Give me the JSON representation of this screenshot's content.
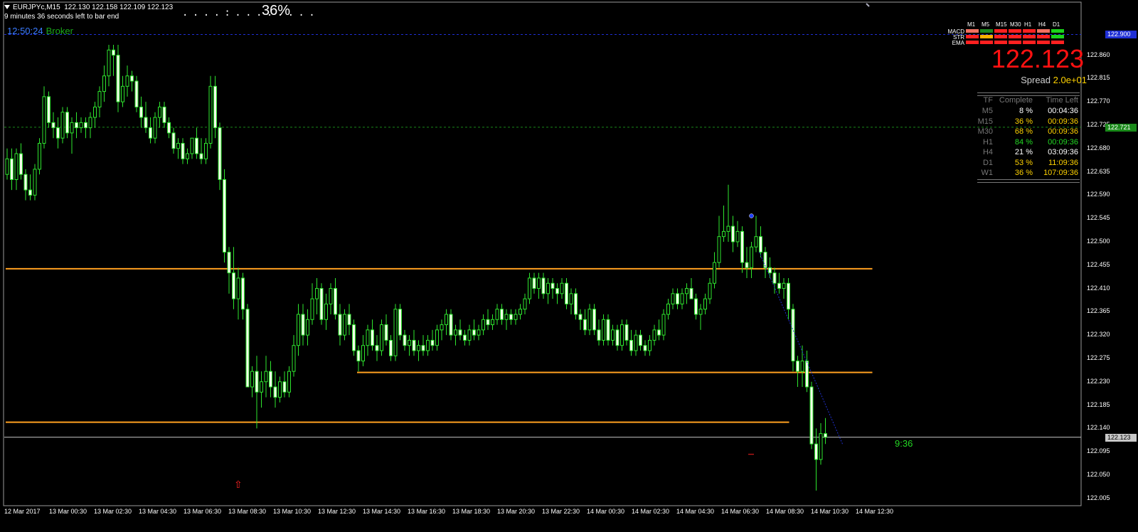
{
  "header": {
    "symbol_line": "EURJPYc,M15  122.130 122.158 122.109 122.123",
    "bar_end_text": "9 minutes 36 seconds left to bar end",
    "progress_dots": ". . . . : . . . . . . . .",
    "progress_percent": "36%",
    "clock": "12:50:24",
    "broker": "Broker"
  },
  "current_price": "122.123",
  "spread": {
    "label": "Spread",
    "value": "2.0e+01"
  },
  "indicators": {
    "timeframes": [
      "M1",
      "M5",
      "M15",
      "M30",
      "H1",
      "H4",
      "D1"
    ],
    "rows": [
      {
        "label": "MACD",
        "colors": [
          "#f07060",
          "#1f8a1f",
          "#ff2020",
          "#ff2020",
          "#ff2020",
          "#f07060",
          "#19d419"
        ]
      },
      {
        "label": "STR",
        "colors": [
          "#ff2020",
          "#ffb000",
          "#ff2020",
          "#ff2020",
          "#ff2020",
          "#ff2020",
          "#19d419"
        ]
      },
      {
        "label": "EMA",
        "colors": [
          "#ff2020",
          "#ff2020",
          "#ff2020",
          "#ff2020",
          "#ff2020",
          "#ff2020",
          "#ff2020"
        ]
      }
    ]
  },
  "tf_table": {
    "headers": [
      "TF",
      "Complete",
      "Time Left"
    ],
    "rows": [
      {
        "tf": "M5",
        "complete": "8 %",
        "left": "00:04:36",
        "color": "#ffffff"
      },
      {
        "tf": "M15",
        "complete": "36 %",
        "left": "00:09:36",
        "color": "#ffd200"
      },
      {
        "tf": "M30",
        "complete": "68 %",
        "left": "00:09:36",
        "color": "#ffd200"
      },
      {
        "tf": "H1",
        "complete": "84 %",
        "left": "00:09:36",
        "color": "#23d723"
      },
      {
        "tf": "H4",
        "complete": "21 %",
        "left": "03:09:36",
        "color": "#ffffff"
      },
      {
        "tf": "D1",
        "complete": "53 %",
        "left": "11:09:36",
        "color": "#ffd200"
      },
      {
        "tf": "W1",
        "complete": "36 %",
        "left": "107:09:36",
        "color": "#ffd200"
      }
    ]
  },
  "countdown": "9:36",
  "arrow_glyph": "⇧",
  "chart_data": {
    "type": "candlestick",
    "symbol": "EURJPYc",
    "timeframe": "M15",
    "ylim": [
      121.995,
      122.95
    ],
    "y_ticks": [
      "122.860",
      "122.815",
      "122.770",
      "122.725",
      "122.680",
      "122.635",
      "122.590",
      "122.545",
      "122.500",
      "122.455",
      "122.410",
      "122.365",
      "122.320",
      "122.275",
      "122.230",
      "122.185",
      "122.140",
      "122.095",
      "122.050",
      "122.005"
    ],
    "x_ticks": [
      "12 Mar 2017",
      "13 Mar 00:30",
      "13 Mar 02:30",
      "13 Mar 04:30",
      "13 Mar 06:30",
      "13 Mar 08:30",
      "13 Mar 10:30",
      "13 Mar 12:30",
      "13 Mar 14:30",
      "13 Mar 16:30",
      "13 Mar 18:30",
      "13 Mar 20:30",
      "13 Mar 22:30",
      "14 Mar 00:30",
      "14 Mar 02:30",
      "14 Mar 04:30",
      "14 Mar 06:30",
      "14 Mar 08:30",
      "14 Mar 10:30",
      "14 Mar 12:30"
    ],
    "price_tags": [
      {
        "label": "122.900",
        "value": 122.9,
        "color": "#1f2fd6"
      },
      {
        "label": "122.721",
        "value": 122.721,
        "color": "#1a8a1a"
      },
      {
        "label": "122.123",
        "value": 122.123,
        "color": "#c8c8c8"
      }
    ],
    "levels": [
      {
        "value": 122.448,
        "from": 0,
        "to": 187,
        "color": "#ffa020"
      },
      {
        "value": 122.248,
        "from": 76,
        "to": 187,
        "color": "#ffa020"
      },
      {
        "value": 122.152,
        "from": 0,
        "to": 169,
        "color": "#ffa020"
      }
    ],
    "candles": [
      [
        122.63,
        122.68,
        122.62,
        122.66
      ],
      [
        122.66,
        122.68,
        122.6,
        122.62
      ],
      [
        122.62,
        122.68,
        122.6,
        122.67
      ],
      [
        122.67,
        122.69,
        122.62,
        122.63
      ],
      [
        122.63,
        122.64,
        122.58,
        122.6
      ],
      [
        122.6,
        122.63,
        122.58,
        122.59
      ],
      [
        122.59,
        122.65,
        122.58,
        122.64
      ],
      [
        122.64,
        122.7,
        122.63,
        122.69
      ],
      [
        122.69,
        122.8,
        122.68,
        122.78
      ],
      [
        122.78,
        122.79,
        122.72,
        122.73
      ],
      [
        122.73,
        122.75,
        122.7,
        122.72
      ],
      [
        122.72,
        122.74,
        122.68,
        122.7
      ],
      [
        122.7,
        122.76,
        122.69,
        122.75
      ],
      [
        122.75,
        122.76,
        122.7,
        122.71
      ],
      [
        122.71,
        122.74,
        122.67,
        122.73
      ],
      [
        122.73,
        122.75,
        122.7,
        122.72
      ],
      [
        122.72,
        122.74,
        122.71,
        122.73
      ],
      [
        122.73,
        122.74,
        122.7,
        122.72
      ],
      [
        122.72,
        122.75,
        122.7,
        122.74
      ],
      [
        122.74,
        122.77,
        122.72,
        122.76
      ],
      [
        122.76,
        122.8,
        122.74,
        122.79
      ],
      [
        122.79,
        122.84,
        122.77,
        122.82
      ],
      [
        122.82,
        122.88,
        122.8,
        122.87
      ],
      [
        122.87,
        122.88,
        122.82,
        122.86
      ],
      [
        122.86,
        122.88,
        122.75,
        122.77
      ],
      [
        122.77,
        122.82,
        122.76,
        122.8
      ],
      [
        122.8,
        122.84,
        122.78,
        122.82
      ],
      [
        122.82,
        122.83,
        122.79,
        122.81
      ],
      [
        122.81,
        122.82,
        122.75,
        122.76
      ],
      [
        122.76,
        122.78,
        122.72,
        122.74
      ],
      [
        122.74,
        122.77,
        122.71,
        122.72
      ],
      [
        122.72,
        122.74,
        122.69,
        122.7
      ],
      [
        122.7,
        122.75,
        122.69,
        122.74
      ],
      [
        122.74,
        122.77,
        122.72,
        122.76
      ],
      [
        122.76,
        122.77,
        122.72,
        122.73
      ],
      [
        122.73,
        122.74,
        122.7,
        122.71
      ],
      [
        122.71,
        122.72,
        122.67,
        122.68
      ],
      [
        122.68,
        122.7,
        122.66,
        122.69
      ],
      [
        122.69,
        122.7,
        122.65,
        122.66
      ],
      [
        122.66,
        122.68,
        122.65,
        122.67
      ],
      [
        122.67,
        122.7,
        122.66,
        122.7
      ],
      [
        122.7,
        122.72,
        122.66,
        122.67
      ],
      [
        122.67,
        122.7,
        122.65,
        122.66
      ],
      [
        122.66,
        122.7,
        122.65,
        122.69
      ],
      [
        122.69,
        122.82,
        122.68,
        122.8
      ],
      [
        122.8,
        122.82,
        122.7,
        122.72
      ],
      [
        122.72,
        122.73,
        122.6,
        122.62
      ],
      [
        122.62,
        122.64,
        122.46,
        122.48
      ],
      [
        122.48,
        122.49,
        122.4,
        122.44
      ],
      [
        122.44,
        122.49,
        122.37,
        122.39
      ],
      [
        122.39,
        122.45,
        122.35,
        122.43
      ],
      [
        122.43,
        122.44,
        122.35,
        122.37
      ],
      [
        122.37,
        122.38,
        122.27,
        122.22
      ],
      [
        122.22,
        122.26,
        122.2,
        122.25
      ],
      [
        122.25,
        122.28,
        122.14,
        122.21
      ],
      [
        122.21,
        122.25,
        122.18,
        122.23
      ],
      [
        122.23,
        122.28,
        122.2,
        122.25
      ],
      [
        122.25,
        122.27,
        122.2,
        122.22
      ],
      [
        122.22,
        122.25,
        122.18,
        122.2
      ],
      [
        122.2,
        122.24,
        122.19,
        122.23
      ],
      [
        122.23,
        122.25,
        122.2,
        122.21
      ],
      [
        122.21,
        122.26,
        122.2,
        122.25
      ],
      [
        122.25,
        122.32,
        122.24,
        122.3
      ],
      [
        122.3,
        122.38,
        122.28,
        122.36
      ],
      [
        122.36,
        122.38,
        122.3,
        122.32
      ],
      [
        122.32,
        122.37,
        122.3,
        122.35
      ],
      [
        122.35,
        122.42,
        122.34,
        122.39
      ],
      [
        122.39,
        122.43,
        122.36,
        122.41
      ],
      [
        122.41,
        122.42,
        122.34,
        122.35
      ],
      [
        122.35,
        122.4,
        122.33,
        122.38
      ],
      [
        122.38,
        122.42,
        122.36,
        122.41
      ],
      [
        122.41,
        122.43,
        122.35,
        122.36
      ],
      [
        122.36,
        122.38,
        122.3,
        122.32
      ],
      [
        122.32,
        122.37,
        122.31,
        122.36
      ],
      [
        122.36,
        122.38,
        122.32,
        122.34
      ],
      [
        122.34,
        122.35,
        122.28,
        122.29
      ],
      [
        122.29,
        122.3,
        122.25,
        122.27
      ],
      [
        122.27,
        122.32,
        122.26,
        122.3
      ],
      [
        122.3,
        122.34,
        122.28,
        122.33
      ],
      [
        122.33,
        122.35,
        122.29,
        122.3
      ],
      [
        122.3,
        122.32,
        122.27,
        122.29
      ],
      [
        122.29,
        122.35,
        122.28,
        122.34
      ],
      [
        122.34,
        122.36,
        122.3,
        122.31
      ],
      [
        122.31,
        122.32,
        122.27,
        122.28
      ],
      [
        122.28,
        122.38,
        122.27,
        122.37
      ],
      [
        122.37,
        122.38,
        122.31,
        122.32
      ],
      [
        122.32,
        122.33,
        122.29,
        122.3
      ],
      [
        122.3,
        122.32,
        122.28,
        122.31
      ],
      [
        122.31,
        122.33,
        122.28,
        122.29
      ],
      [
        122.29,
        122.31,
        122.27,
        122.3
      ],
      [
        122.3,
        122.32,
        122.28,
        122.29
      ],
      [
        122.29,
        122.32,
        122.28,
        122.31
      ],
      [
        122.31,
        122.33,
        122.29,
        122.3
      ],
      [
        122.3,
        122.34,
        122.29,
        122.33
      ],
      [
        122.33,
        122.35,
        122.31,
        122.34
      ],
      [
        122.34,
        122.37,
        122.32,
        122.36
      ],
      [
        122.36,
        122.37,
        122.31,
        122.32
      ],
      [
        122.32,
        122.34,
        122.3,
        122.33
      ],
      [
        122.33,
        122.35,
        122.31,
        122.32
      ],
      [
        122.32,
        122.33,
        122.3,
        122.31
      ],
      [
        122.31,
        122.34,
        122.3,
        122.33
      ],
      [
        122.33,
        122.35,
        122.31,
        122.32
      ],
      [
        122.32,
        122.34,
        122.31,
        122.33
      ],
      [
        122.33,
        122.36,
        122.32,
        122.35
      ],
      [
        122.35,
        122.37,
        122.33,
        122.34
      ],
      [
        122.34,
        122.36,
        122.33,
        122.35
      ],
      [
        122.35,
        122.38,
        122.34,
        122.37
      ],
      [
        122.37,
        122.38,
        122.34,
        122.35
      ],
      [
        122.35,
        122.37,
        122.33,
        122.36
      ],
      [
        122.36,
        122.37,
        122.34,
        122.35
      ],
      [
        122.35,
        122.37,
        122.34,
        122.36
      ],
      [
        122.36,
        122.38,
        122.35,
        122.37
      ],
      [
        122.37,
        122.4,
        122.36,
        122.39
      ],
      [
        122.39,
        122.44,
        122.38,
        122.43
      ],
      [
        122.43,
        122.44,
        122.4,
        122.41
      ],
      [
        122.41,
        122.44,
        122.39,
        122.43
      ],
      [
        122.43,
        122.44,
        122.39,
        122.4
      ],
      [
        122.4,
        122.43,
        122.38,
        122.42
      ],
      [
        122.42,
        122.43,
        122.39,
        122.41
      ],
      [
        122.41,
        122.42,
        122.38,
        122.4
      ],
      [
        122.4,
        122.43,
        122.39,
        122.42
      ],
      [
        122.42,
        122.43,
        122.37,
        122.38
      ],
      [
        122.38,
        122.41,
        122.36,
        122.4
      ],
      [
        122.4,
        122.41,
        122.35,
        122.36
      ],
      [
        122.36,
        122.37,
        122.33,
        122.35
      ],
      [
        122.35,
        122.37,
        122.32,
        122.33
      ],
      [
        122.33,
        122.38,
        122.32,
        122.37
      ],
      [
        122.37,
        122.38,
        122.32,
        122.33
      ],
      [
        122.33,
        122.35,
        122.3,
        122.31
      ],
      [
        122.31,
        122.36,
        122.3,
        122.35
      ],
      [
        122.35,
        122.36,
        122.3,
        122.31
      ],
      [
        122.31,
        122.34,
        122.3,
        122.33
      ],
      [
        122.33,
        122.34,
        122.29,
        122.3
      ],
      [
        122.3,
        122.35,
        122.29,
        122.34
      ],
      [
        122.34,
        122.35,
        122.3,
        122.31
      ],
      [
        122.31,
        122.33,
        122.28,
        122.29
      ],
      [
        122.29,
        122.33,
        122.28,
        122.32
      ],
      [
        122.32,
        122.33,
        122.29,
        122.3
      ],
      [
        122.3,
        122.31,
        122.28,
        122.29
      ],
      [
        122.29,
        122.32,
        122.28,
        122.31
      ],
      [
        122.31,
        122.34,
        122.3,
        122.33
      ],
      [
        122.33,
        122.35,
        122.31,
        122.32
      ],
      [
        122.32,
        122.37,
        122.31,
        122.36
      ],
      [
        122.36,
        122.39,
        122.35,
        122.38
      ],
      [
        122.38,
        122.41,
        122.37,
        122.4
      ],
      [
        122.4,
        122.41,
        122.37,
        122.38
      ],
      [
        122.38,
        122.41,
        122.37,
        122.4
      ],
      [
        122.4,
        122.42,
        122.38,
        122.41
      ],
      [
        122.41,
        122.43,
        122.39,
        122.39
      ],
      [
        122.39,
        122.4,
        122.35,
        122.36
      ],
      [
        122.36,
        122.38,
        122.33,
        122.37
      ],
      [
        122.37,
        122.4,
        122.36,
        122.39
      ],
      [
        122.39,
        122.43,
        122.38,
        122.42
      ],
      [
        122.42,
        122.48,
        122.41,
        122.46
      ],
      [
        122.46,
        122.55,
        122.45,
        122.51
      ],
      [
        122.51,
        122.57,
        122.5,
        122.52
      ],
      [
        122.52,
        122.61,
        122.5,
        122.53
      ],
      [
        122.53,
        122.55,
        122.48,
        122.5
      ],
      [
        122.5,
        122.54,
        122.49,
        122.52
      ],
      [
        122.52,
        122.53,
        122.44,
        122.46
      ],
      [
        122.46,
        122.49,
        122.43,
        122.45
      ],
      [
        122.45,
        122.5,
        122.43,
        122.49
      ],
      [
        122.49,
        122.55,
        122.48,
        122.51
      ],
      [
        122.51,
        122.53,
        122.47,
        122.48
      ],
      [
        122.48,
        122.49,
        122.43,
        122.45
      ],
      [
        122.45,
        122.47,
        122.43,
        122.44
      ],
      [
        122.44,
        122.45,
        122.4,
        122.42
      ],
      [
        122.42,
        122.44,
        122.4,
        122.41
      ],
      [
        122.41,
        122.43,
        122.39,
        122.42
      ],
      [
        122.42,
        122.43,
        122.35,
        122.37
      ],
      [
        122.37,
        122.38,
        122.25,
        122.27
      ],
      [
        122.27,
        122.28,
        122.22,
        122.25
      ],
      [
        122.25,
        122.3,
        122.22,
        122.27
      ],
      [
        122.27,
        122.29,
        122.21,
        122.22
      ],
      [
        122.22,
        122.23,
        122.1,
        122.11
      ],
      [
        122.11,
        122.14,
        122.02,
        122.08
      ],
      [
        122.08,
        122.15,
        122.07,
        122.13
      ],
      [
        122.13,
        122.16,
        122.11,
        122.123
      ]
    ]
  }
}
